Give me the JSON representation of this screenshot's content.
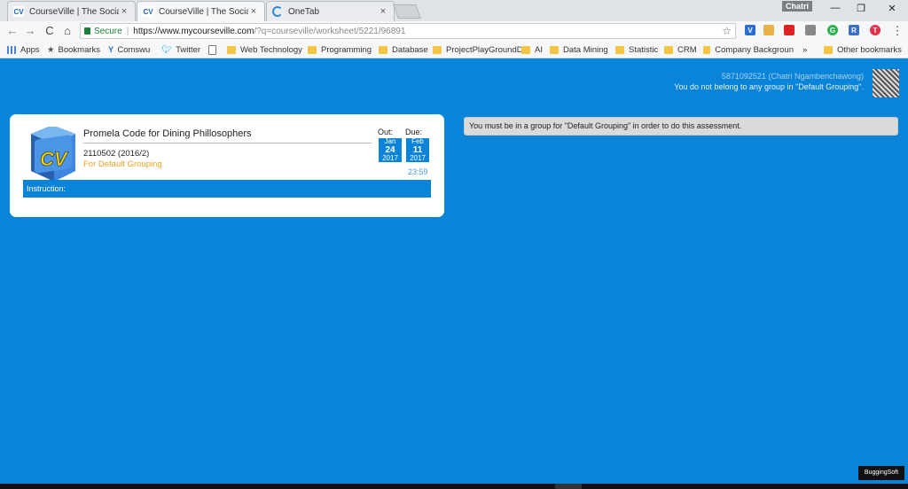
{
  "tabs": [
    {
      "icon": "cv-favicon",
      "title": "CourseVille | The Social L",
      "close": "×"
    },
    {
      "icon": "cv-favicon",
      "title": "CourseVille | The Social L",
      "close": "×"
    },
    {
      "icon": "onetab-favicon",
      "title": "OneTab",
      "close": "×"
    }
  ],
  "window": {
    "user": "Chatri",
    "minimize": "—",
    "restore": "❐",
    "close": "✕"
  },
  "nav": {
    "back": "←",
    "forward": "→",
    "reload": "C",
    "home": "⌂"
  },
  "address": {
    "secure_label": "Secure",
    "url_host": "https://www.mycourseville.com",
    "url_path": "/?q=courseville/worksheet/5221/96891",
    "star": "☆"
  },
  "bookmarks": [
    {
      "label": "Apps",
      "icon": "apps-grid-icon"
    },
    {
      "label": "Bookmarks",
      "icon": "star-icon"
    },
    {
      "label": "Comswu",
      "icon": "site-icon"
    },
    {
      "label": "Twitter",
      "icon": "twitter-icon"
    },
    {
      "label": "",
      "icon": "page-icon"
    },
    {
      "label": "Web Technology",
      "icon": "folder-icon"
    },
    {
      "label": "Programming",
      "icon": "folder-icon"
    },
    {
      "label": "Database",
      "icon": "folder-icon"
    },
    {
      "label": "ProjectPlayGroundD",
      "icon": "folder-icon"
    },
    {
      "label": "AI",
      "icon": "folder-icon"
    },
    {
      "label": "Data Mining",
      "icon": "folder-icon"
    },
    {
      "label": "Statistic",
      "icon": "folder-icon"
    },
    {
      "label": "CRM",
      "icon": "folder-icon"
    },
    {
      "label": "Company Backgroun",
      "icon": "folder-icon"
    },
    {
      "label": "»",
      "icon": ""
    },
    {
      "label": "Other bookmarks",
      "icon": "folder-icon"
    }
  ],
  "user_panel": {
    "id_line": "5871092521 (Chatri Ngambenchawong)",
    "group_note": "You do not belong to any group in \"Default Grouping\"."
  },
  "worksheet": {
    "title": "Promela Code for Dining Phillosophers",
    "course": "2110502 (2016/2)",
    "grouping": "For Default Grouping",
    "out_label": "Out:",
    "due_label": "Due:",
    "out_date": {
      "month": "Jan",
      "day": "24",
      "year": "2017"
    },
    "due_date": {
      "month": "Feb",
      "day": "11",
      "year": "2017"
    },
    "due_time": "23:59",
    "instruction_label": "Instruction:"
  },
  "alert": {
    "message": "You must be in a group for \"Default Grouping\" in order to do this assessment."
  },
  "watermark": "BuggingSoft",
  "colors": {
    "accent": "#0a84d8",
    "grouping": "#f0a020",
    "alert_bg": "#dadada"
  }
}
